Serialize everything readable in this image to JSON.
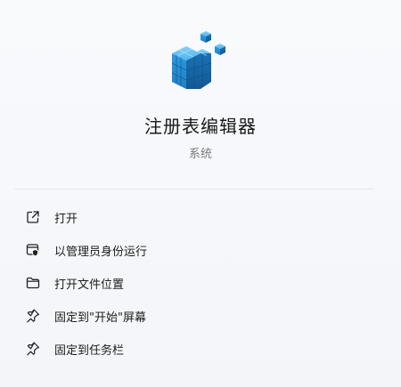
{
  "app": {
    "title": "注册表编辑器",
    "category": "系统",
    "icon": "registry-cubes-icon",
    "accent": "#2d8fd6"
  },
  "menu": {
    "items": [
      {
        "label": "打开",
        "icon": "open-external-icon"
      },
      {
        "label": "以管理员身份运行",
        "icon": "shield-admin-icon"
      },
      {
        "label": "打开文件位置",
        "icon": "folder-icon"
      },
      {
        "label": "固定到\"开始\"屏幕",
        "icon": "pin-icon"
      },
      {
        "label": "固定到任务栏",
        "icon": "pin-icon"
      }
    ]
  }
}
